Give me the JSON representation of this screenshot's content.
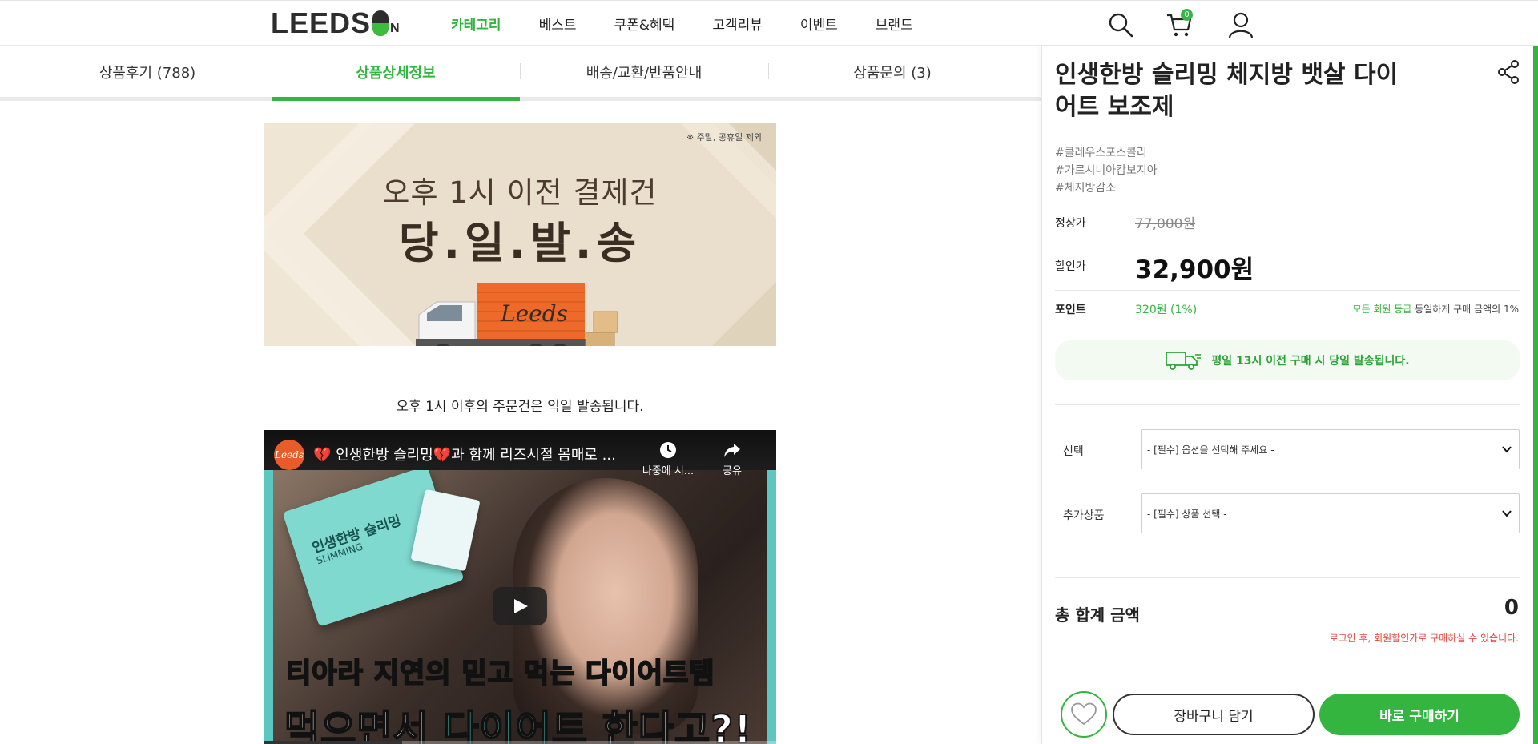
{
  "header": {
    "logo": "LEEDS",
    "logo_suffix": "N",
    "nav": [
      "카테고리",
      "베스트",
      "쿠폰&혜택",
      "고객리뷰",
      "이벤트",
      "브랜드"
    ],
    "cart_count": "0",
    "accent_color": "#33b53f"
  },
  "tabs": [
    "상품후기 (788)",
    "상품상세정보",
    "배송/교환/반품안내",
    "상품문의 (3)"
  ],
  "banner": {
    "note": "※ 주말, 공휴일 제외",
    "line1": "오후 1시 이전 결제건",
    "line2": "당.일.발.송",
    "truck_label": "Leeds",
    "after_note": "오후 1시 이후의 주문건은 익일 발송됩니다."
  },
  "video": {
    "channel_logo": "Leeds",
    "title": "💔 인생한방 슬리밍💔과 함께 리즈시절 몸매로 ...",
    "later_label": "나중에 시...",
    "share_label": "공유",
    "box_text": "인생한방 슬리밍",
    "box_sub": "SLIMMING",
    "caption1_a": "티아라 지연의 ",
    "caption1_b": "믿",
    "caption1_c": "고 ",
    "caption1_d": "먹",
    "caption1_e": "는 다이어트",
    "caption1_f": "템",
    "caption2_a": "먹으면서 ",
    "caption2_b": "다이어트",
    "caption2_c": " 한다고?!",
    "progress": 0.27
  },
  "product": {
    "title": "인생한방 슬리밍 체지방 뱃살 다이어트 보조제",
    "tags": [
      "#클레우스포스콜리",
      "#가르시니아캄보지아",
      "#체지방감소"
    ],
    "regular_label": "정상가",
    "regular_price": "77,000원",
    "sale_label": "할인가",
    "sale_price": "32,900원",
    "point_label": "포인트",
    "point_value": "320원 (1%)",
    "point_note_green": "모든 회원 등급",
    "point_note": " 동일하게 구매 금액의 1%",
    "shipping_note": "평일 13시 이전 구매 시 당일 발송됩니다.",
    "option_label": "선택",
    "option_placeholder": "- [필수] 옵션을 선택해 주세요 -",
    "addon_label": "추가상품",
    "addon_placeholder": "- [필수] 상품 선택 -",
    "total_label": "총 합계 금액",
    "total_value": "0",
    "login_note": "로그인 후, 회원할인가로 구매하실 수 있습니다.",
    "cart_button": "장바구니 담기",
    "buy_button": "바로 구매하기"
  }
}
